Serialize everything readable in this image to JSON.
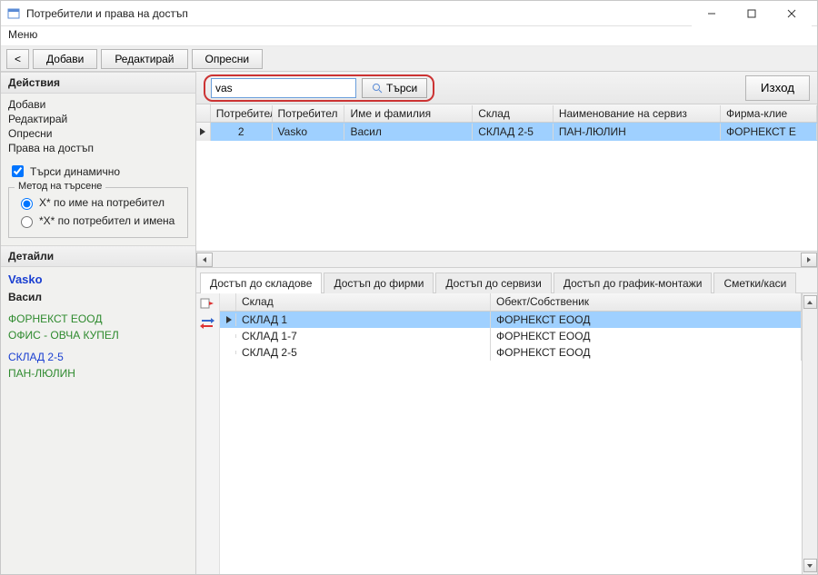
{
  "window": {
    "title": "Потребители и права на достъп",
    "menu": "Меню"
  },
  "toolbar": {
    "back": "<",
    "add": "Добави",
    "edit": "Редактирай",
    "refresh": "Опресни"
  },
  "side": {
    "actions_hdr": "Действия",
    "actions": {
      "add": "Добави",
      "edit": "Редактирай",
      "refresh": "Опресни",
      "rights": "Права на достъп"
    },
    "dyn_search": "Търси динамично",
    "dyn_checked": true,
    "method_legend": "Метод на търсене",
    "radio1": "X* по име на потребител",
    "radio2": "*X* по потребител и имена",
    "details_hdr": "Детайли",
    "details": {
      "user": "Vasko",
      "name": "Васил",
      "firm": "ФОРНЕКСТ ЕООД",
      "office": "ОФИС - ОВЧА КУПЕЛ",
      "sklad": "СКЛАД 2-5",
      "service": "ПАН-ЛЮЛИН"
    }
  },
  "search": {
    "value": "vas",
    "btn": "Търси",
    "exit": "Изход"
  },
  "grid": {
    "cols": {
      "c1": "Потребител №",
      "c2": "Потребител",
      "c3": "Име и фамилия",
      "c4": "Склад",
      "c5": "Наименование на сервиз",
      "c6": "Фирма-клие"
    },
    "rows": [
      {
        "c1": "2",
        "c2": "Vasko",
        "c3": "Васил",
        "c4": "СКЛАД 2-5",
        "c5": "ПАН-ЛЮЛИН",
        "c6": "ФОРНЕКСТ Е"
      }
    ]
  },
  "tabs": {
    "t1": "Достъп до складове",
    "t2": "Достъп до фирми",
    "t3": "Достъп до сервизи",
    "t4": "Достъп до график-монтажи",
    "t5": "Сметки/каси"
  },
  "dgrid": {
    "cols": {
      "c1": "Склад",
      "c2": "Обект/Собственик"
    },
    "rows": [
      {
        "c1": "СКЛАД 1",
        "c2": "ФОРНЕКСТ ЕООД",
        "sel": true
      },
      {
        "c1": "СКЛАД 1-7",
        "c2": "ФОРНЕКСТ ЕООД",
        "sel": false
      },
      {
        "c1": "СКЛАД 2-5",
        "c2": "ФОРНЕКСТ ЕООД",
        "sel": false
      }
    ]
  }
}
